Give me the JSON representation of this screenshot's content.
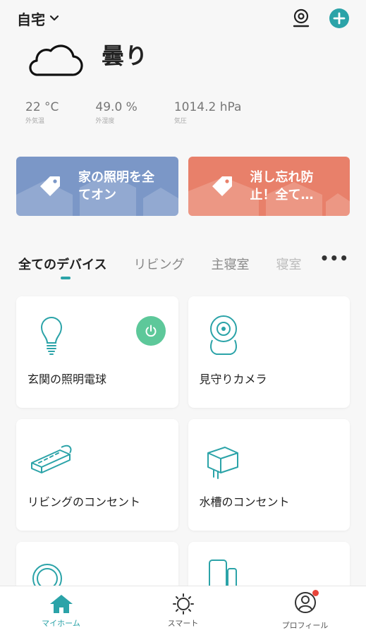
{
  "header": {
    "home_label": "自宅",
    "icons": {
      "dropdown": "chevron-down-icon",
      "camera": "camera-icon",
      "add": "plus-circle-icon"
    },
    "accent_color": "#2ba3a8"
  },
  "weather": {
    "condition": "曇り",
    "icon": "cloud-icon",
    "stats": [
      {
        "value": "22 °C",
        "label": "外気温"
      },
      {
        "value": "49.0 %",
        "label": "外湿度"
      },
      {
        "value": "1014.2 hPa",
        "label": "気圧"
      }
    ]
  },
  "scenes": [
    {
      "label": "家の照明を全てオン",
      "color": "#7b97c7",
      "icon": "tag-icon"
    },
    {
      "label": "消し忘れ防止！全て…",
      "color": "#e8806a",
      "icon": "tag-icon"
    }
  ],
  "tabs": [
    {
      "label": "全てのデバイス",
      "active": true
    },
    {
      "label": "リビング"
    },
    {
      "label": "主寝室"
    },
    {
      "label": "寝室"
    }
  ],
  "more_label": "•••",
  "devices": [
    {
      "name": "玄関の照明電球",
      "icon": "light-bulb-icon",
      "power_on": true
    },
    {
      "name": "見守りカメラ",
      "icon": "security-camera-icon"
    },
    {
      "name": "リビングのコンセント",
      "icon": "power-strip-icon"
    },
    {
      "name": "水槽のコンセント",
      "icon": "smart-plug-icon"
    },
    {
      "name": "",
      "icon": "cable-icon"
    },
    {
      "name": "",
      "icon": "door-sensor-icon"
    }
  ],
  "power_color": "#5dc89a",
  "bottom_nav": [
    {
      "label": "マイホーム",
      "icon": "home-icon",
      "active": true
    },
    {
      "label": "スマート",
      "icon": "sun-icon"
    },
    {
      "label": "プロフィール",
      "icon": "profile-icon",
      "badge": true
    }
  ]
}
